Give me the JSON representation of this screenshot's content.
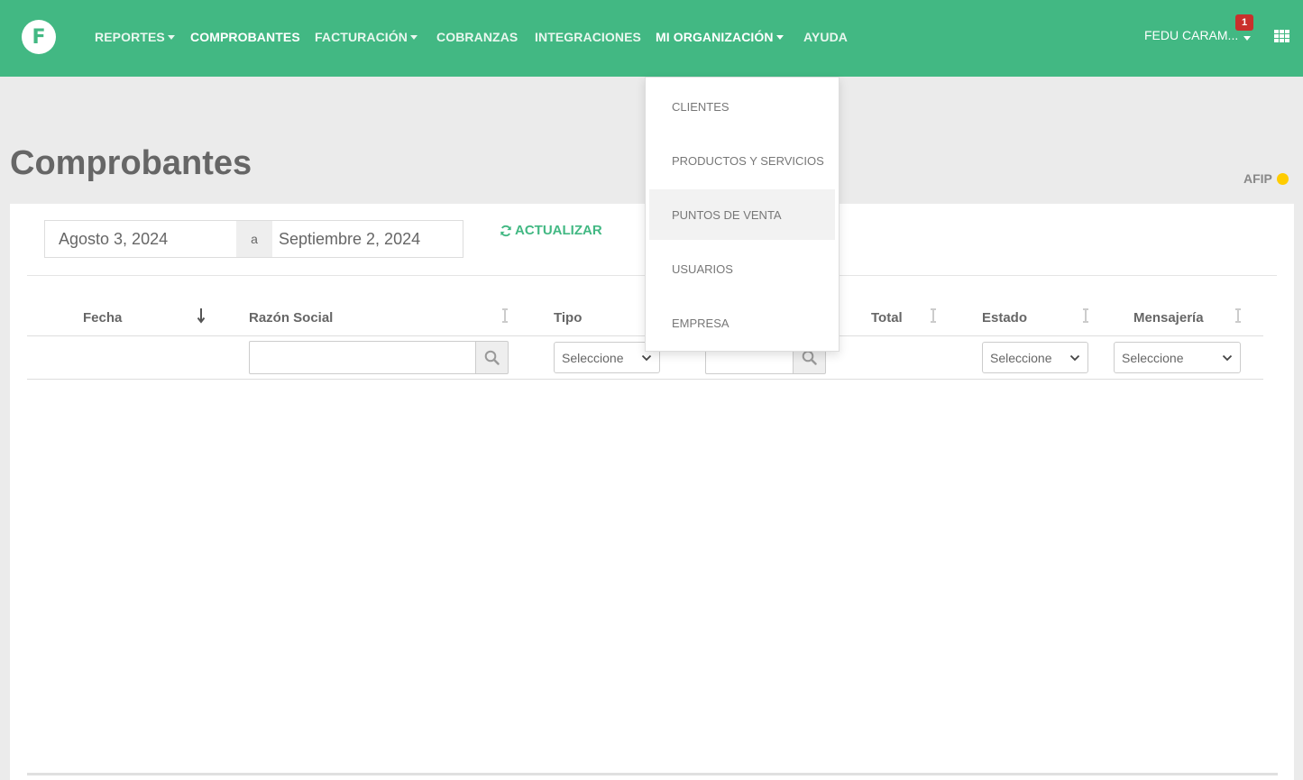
{
  "brand": {
    "logo_letter": "F",
    "color": "#42b883"
  },
  "nav": {
    "items": [
      {
        "label": "REPORTES",
        "has_caret": true
      },
      {
        "label": "COMPROBANTES",
        "has_caret": false,
        "active": true
      },
      {
        "label": "FACTURACIÓN",
        "has_caret": true
      },
      {
        "label": "COBRANZAS",
        "has_caret": false
      },
      {
        "label": "INTEGRACIONES",
        "has_caret": false
      },
      {
        "label": "MI ORGANIZACIÓN",
        "has_caret": true
      },
      {
        "label": "AYUDA",
        "has_caret": false
      }
    ],
    "user_name": "FEDU CARAM...",
    "notification_count": "1",
    "apps_icon": "grid-icon"
  },
  "dropdown": {
    "items": [
      {
        "label": "CLIENTES"
      },
      {
        "label": "PRODUCTOS Y SERVICIOS"
      },
      {
        "label": "PUNTOS DE VENTA",
        "hover": true
      },
      {
        "label": "USUARIOS"
      },
      {
        "label": "EMPRESA"
      }
    ]
  },
  "page": {
    "title": "Comprobantes",
    "afip_label": "AFIP",
    "afip_status_color": "#ffcc00"
  },
  "date_range": {
    "from": "Agosto 3, 2024",
    "separator": "a",
    "to": "Septiembre 2, 2024"
  },
  "refresh_label": "ACTUALIZAR",
  "table": {
    "columns": {
      "fecha": "Fecha",
      "razon_social": "Razón Social",
      "tipo": "Tipo",
      "total": "Total",
      "estado": "Estado",
      "mensajeria": "Mensajería"
    },
    "filters": {
      "select_placeholder": "Seleccione"
    }
  }
}
